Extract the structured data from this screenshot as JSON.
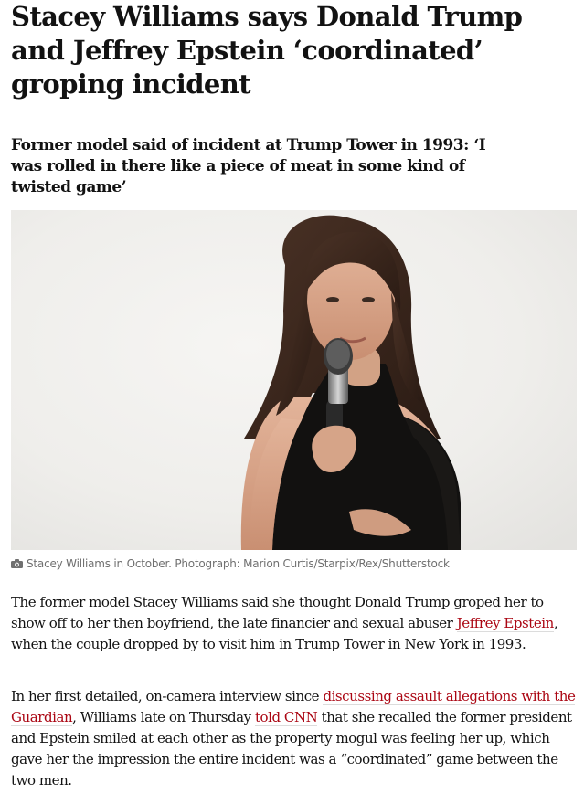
{
  "article": {
    "headline": "Stacey Williams says Donald Trump and Jeffrey Epstein ‘coordinated’ groping incident",
    "standfirst": "Former model said of incident at Trump Tower in 1993: ‘I was rolled in there like a piece of meat in some kind of twisted game’",
    "image": {
      "caption": "Stacey Williams in October. Photograph: Marion Curtis/Starpix/Rex/Shutterstock",
      "icon": "camera-icon"
    },
    "paragraph1": {
      "text_a": "The former model Stacey Williams said she thought Donald Trump groped her to show off to her then boyfriend, the late financier and sexual abuser ",
      "link_a": "Jeffrey Epstein",
      "text_b": ", when the couple dropped by to visit him in Trump Tower in New York in 1993."
    },
    "paragraph2": {
      "text_a": "In her first detailed, on-camera interview since ",
      "link_a": "discussing assault allegations with the Guardian",
      "text_b": ", Williams late on Thursday ",
      "link_b": "told CNN",
      "text_c": " that she recalled the former president and Epstein smiled at each other as the property mogul was feeling her up, which gave her the impression the entire incident was a “coordinated” game between the two men."
    }
  },
  "colors": {
    "text": "#121212",
    "link": "#ab0613",
    "caption": "#707070"
  }
}
